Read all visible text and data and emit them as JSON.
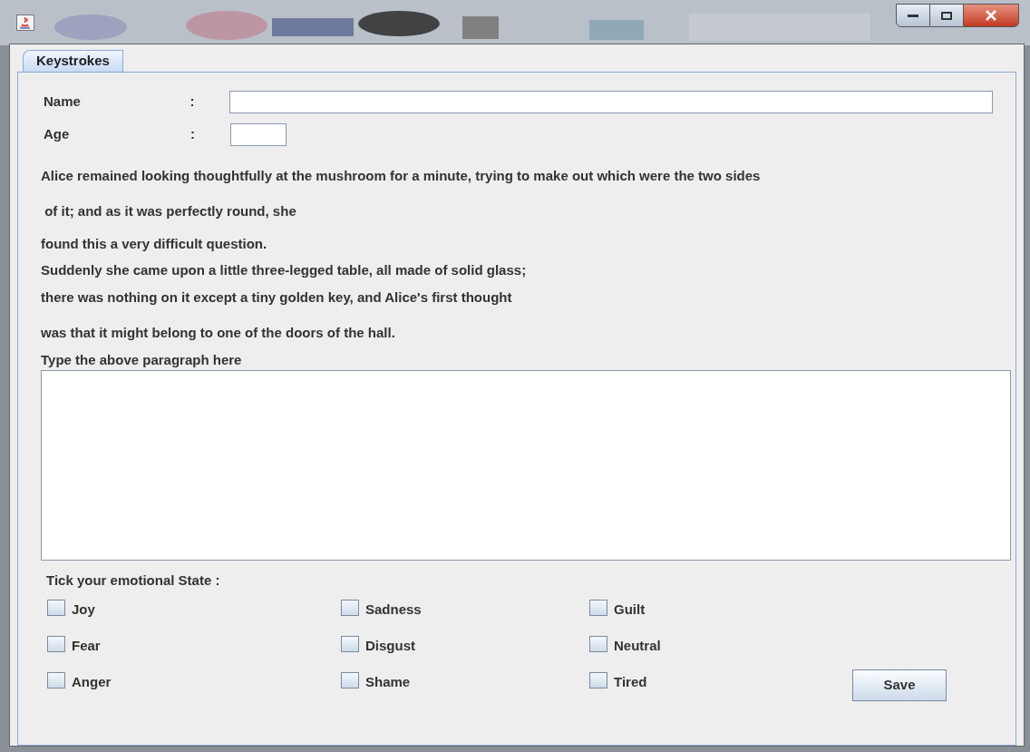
{
  "tabs": [
    {
      "label": "Keystrokes",
      "selected": true
    }
  ],
  "form": {
    "fields": [
      {
        "label": "Name",
        "colon": ":",
        "kind": "wide"
      },
      {
        "label": "Age",
        "colon": ":",
        "kind": "short"
      }
    ],
    "paragraph": [
      "Alice remained looking thoughtfully at the mushroom for a minute, trying to make out which were the two sides",
      " of it; and as it was perfectly round, she",
      "found this a very difficult question.",
      "Suddenly she came upon a little three-legged table, all made of solid glass;",
      "there was nothing on it except a tiny golden key, and Alice's first thought",
      "was that it might belong to one of the doors of the hall."
    ],
    "typing_label": "Type the above paragraph here",
    "emotions_label": "Tick your emotional State :",
    "emotions": [
      {
        "label": "Joy",
        "checked": false
      },
      {
        "label": "Sadness",
        "checked": false
      },
      {
        "label": "Guilt",
        "checked": false
      },
      {
        "label": "Fear",
        "checked": false
      },
      {
        "label": "Disgust",
        "checked": false
      },
      {
        "label": "Neutral",
        "checked": false
      },
      {
        "label": "Anger",
        "checked": false
      },
      {
        "label": "Shame",
        "checked": false
      },
      {
        "label": "Tired",
        "checked": false
      }
    ],
    "save_button": "Save"
  }
}
